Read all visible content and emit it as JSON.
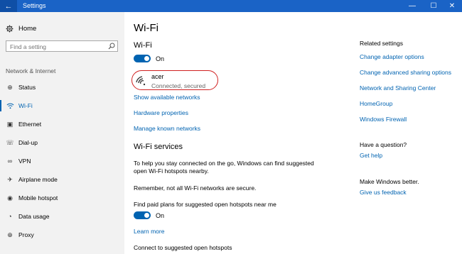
{
  "window": {
    "title": "Settings",
    "back_glyph": "←",
    "min_glyph": "—",
    "max_glyph": "☐",
    "close_glyph": "✕"
  },
  "sidebar": {
    "home_label": "Home",
    "search_placeholder": "Find a setting",
    "section_label": "Network & Internet",
    "items": [
      {
        "label": "Status",
        "icon": "globe-icon",
        "glyph": "⊕"
      },
      {
        "label": "Wi-Fi",
        "icon": "wifi-icon",
        "glyph": "◠"
      },
      {
        "label": "Ethernet",
        "icon": "ethernet-icon",
        "glyph": "▣"
      },
      {
        "label": "Dial-up",
        "icon": "phone-icon",
        "glyph": "☏"
      },
      {
        "label": "VPN",
        "icon": "vpn-icon",
        "glyph": "∞"
      },
      {
        "label": "Airplane mode",
        "icon": "airplane-icon",
        "glyph": "✈"
      },
      {
        "label": "Mobile hotspot",
        "icon": "hotspot-icon",
        "glyph": "◉"
      },
      {
        "label": "Data usage",
        "icon": "data-usage-icon",
        "glyph": "◔"
      },
      {
        "label": "Proxy",
        "icon": "proxy-icon",
        "glyph": "⊕"
      }
    ],
    "active_index": 1
  },
  "main": {
    "title": "Wi-Fi",
    "wifi_heading": "Wi-Fi",
    "wifi_toggle_label": "On",
    "wifi_enabled": true,
    "network": {
      "name": "acer",
      "status": "Connected, secured"
    },
    "links": {
      "show_networks": "Show available networks",
      "hardware": "Hardware properties",
      "manage": "Manage known networks"
    },
    "services": {
      "heading": "Wi-Fi services",
      "description": "To help you stay connected on the go, Windows can find suggested open Wi-Fi hotspots nearby.",
      "note": "Remember, not all Wi-Fi networks are secure.",
      "paid_plans_label": "Find paid plans for suggested open hotspots near me",
      "paid_toggle_label": "On",
      "paid_enabled": true,
      "learn_more": "Learn more",
      "connect_label": "Connect to suggested open hotspots"
    }
  },
  "related": {
    "heading": "Related settings",
    "links": [
      "Change adapter options",
      "Change advanced sharing options",
      "Network and Sharing Center",
      "HomeGroup",
      "Windows Firewall"
    ],
    "question_heading": "Have a question?",
    "get_help": "Get help",
    "better_heading": "Make Windows better.",
    "feedback": "Give us feedback"
  },
  "colors": {
    "accent": "#0063b1",
    "titlebar": "#1a63c6",
    "highlight_ring": "#d02020"
  }
}
